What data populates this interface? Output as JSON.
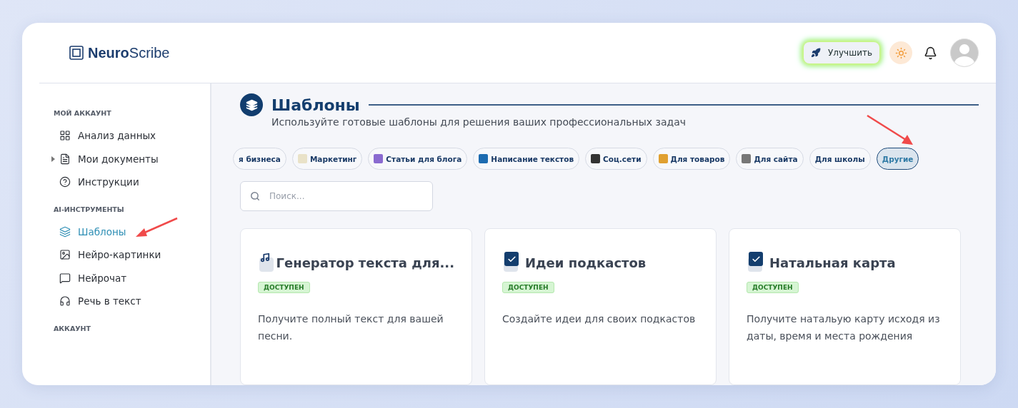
{
  "logo": {
    "bold": "Neuro",
    "light": "Scribe"
  },
  "header": {
    "upgrade": "Улучшить"
  },
  "sidebar": {
    "sections": [
      {
        "title": "МОЙ АККАУНТ",
        "items": [
          {
            "label": "Анализ данных",
            "kind": "link",
            "selected": false
          },
          {
            "label": "Мои документы",
            "kind": "group",
            "selected": false
          },
          {
            "label": "Инструкции",
            "kind": "link",
            "selected": false
          }
        ]
      },
      {
        "title": "AI-ИНСТРУМЕНТЫ",
        "items": [
          {
            "label": "Шаблоны",
            "kind": "link",
            "selected": true
          },
          {
            "label": "Нейро-картинки",
            "kind": "link",
            "selected": false
          },
          {
            "label": "Нейрочат",
            "kind": "link",
            "selected": false
          },
          {
            "label": "Речь в текст",
            "kind": "link",
            "selected": false
          }
        ]
      },
      {
        "title": "АККАУНТ"
      }
    ]
  },
  "page": {
    "title": "Шаблоны",
    "subtitle": "Используйте готовые шаблоны для решения ваших профессиональных задач"
  },
  "categories": [
    {
      "label": "я бизнеса",
      "kind": "plain",
      "selected": false
    },
    {
      "label": "Маркетинг",
      "kind": "icon",
      "selected": false
    },
    {
      "label": "Статьи для блога",
      "kind": "icon",
      "selected": false
    },
    {
      "label": "Написание текстов",
      "kind": "icon",
      "selected": false
    },
    {
      "label": "Соц.сети",
      "kind": "icon",
      "selected": false
    },
    {
      "label": "Для товаров",
      "kind": "icon",
      "selected": false
    },
    {
      "label": "Для сайта",
      "kind": "icon",
      "selected": false
    },
    {
      "label": "Для школы",
      "kind": "plain",
      "selected": false
    },
    {
      "label": "Другие",
      "kind": "plain",
      "selected": true
    }
  ],
  "search": {
    "placeholder": "Поиск..."
  },
  "cards": [
    {
      "kind": "music",
      "title": "Генератор текста для...",
      "badge": "ДОСТУПЕН",
      "description": "Получите полный текст для вашей песни."
    },
    {
      "kind": "check",
      "title": "Идеи подкастов",
      "badge": "ДОСТУПЕН",
      "description": "Создайте идеи для своих подкастов"
    },
    {
      "kind": "check",
      "title": "Натальная карта",
      "badge": "ДОСТУПЕН",
      "description": "Получите натальую карту исходя из даты, время и места рождения"
    }
  ]
}
